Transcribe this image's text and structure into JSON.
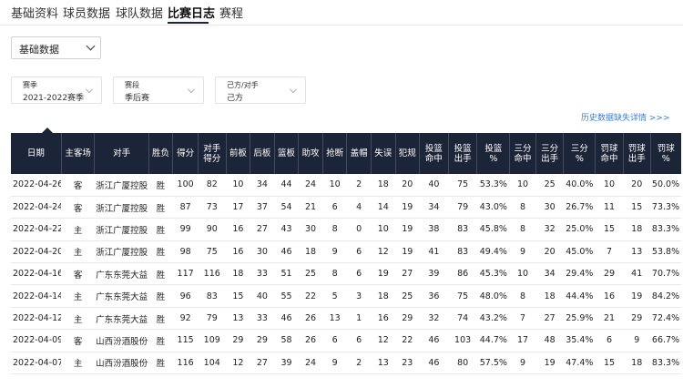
{
  "tabs": [
    {
      "label": "基础资料"
    },
    {
      "label": "球员数据"
    },
    {
      "label": "球队数据"
    },
    {
      "label": "比赛日志"
    },
    {
      "label": "赛程"
    }
  ],
  "stat_select": {
    "value": "基础数据"
  },
  "filters": [
    {
      "label": "赛季",
      "value": "2021-2022赛季"
    },
    {
      "label": "赛段",
      "value": "季后赛"
    },
    {
      "label": "己方/对手",
      "value": "己方"
    }
  ],
  "history_link": "历史数据缺失详情 >>>",
  "table": {
    "headers": [
      [
        "日期"
      ],
      [
        "主客场"
      ],
      [
        "对手"
      ],
      [
        "胜负"
      ],
      [
        "得分"
      ],
      [
        "对手",
        "得分"
      ],
      [
        "前板"
      ],
      [
        "后板"
      ],
      [
        "篮板"
      ],
      [
        "助攻"
      ],
      [
        "抢断"
      ],
      [
        "盖帽"
      ],
      [
        "失误"
      ],
      [
        "犯规"
      ],
      [
        "投篮",
        "命中"
      ],
      [
        "投篮",
        "出手"
      ],
      [
        "投篮",
        "%"
      ],
      [
        "三分",
        "命中"
      ],
      [
        "三分",
        "出手"
      ],
      [
        "三分",
        "%"
      ],
      [
        "罚球",
        "命中"
      ],
      [
        "罚球",
        "出手"
      ],
      [
        "罚球",
        "%"
      ]
    ],
    "rows": [
      [
        "2022-04-26",
        "客",
        "浙江广厦控股",
        "胜",
        "100",
        "82",
        "10",
        "34",
        "44",
        "24",
        "10",
        "2",
        "18",
        "20",
        "40",
        "75",
        "53.3%",
        "10",
        "25",
        "40.0%",
        "10",
        "20",
        "50.0%"
      ],
      [
        "2022-04-24",
        "客",
        "浙江广厦控股",
        "胜",
        "87",
        "73",
        "17",
        "37",
        "54",
        "21",
        "6",
        "4",
        "14",
        "19",
        "34",
        "79",
        "43.0%",
        "8",
        "30",
        "26.7%",
        "11",
        "15",
        "73.3%"
      ],
      [
        "2022-04-22",
        "主",
        "浙江广厦控股",
        "胜",
        "99",
        "90",
        "16",
        "27",
        "43",
        "30",
        "8",
        "0",
        "10",
        "19",
        "38",
        "83",
        "45.8%",
        "8",
        "32",
        "25.0%",
        "15",
        "18",
        "83.3%"
      ],
      [
        "2022-04-20",
        "主",
        "浙江广厦控股",
        "胜",
        "98",
        "75",
        "16",
        "30",
        "46",
        "18",
        "9",
        "6",
        "12",
        "19",
        "41",
        "83",
        "49.4%",
        "9",
        "20",
        "45.0%",
        "7",
        "13",
        "53.8%"
      ],
      [
        "2022-04-16",
        "客",
        "广东东莞大益",
        "胜",
        "117",
        "116",
        "18",
        "33",
        "51",
        "25",
        "8",
        "6",
        "19",
        "27",
        "39",
        "86",
        "45.3%",
        "10",
        "34",
        "29.4%",
        "29",
        "41",
        "70.7%"
      ],
      [
        "2022-04-14",
        "主",
        "广东东莞大益",
        "胜",
        "96",
        "83",
        "15",
        "40",
        "55",
        "22",
        "5",
        "3",
        "18",
        "25",
        "36",
        "75",
        "48.0%",
        "8",
        "18",
        "44.4%",
        "16",
        "19",
        "84.2%"
      ],
      [
        "2022-04-12",
        "主",
        "广东东莞大益",
        "胜",
        "92",
        "79",
        "13",
        "33",
        "46",
        "26",
        "13",
        "1",
        "16",
        "29",
        "32",
        "74",
        "43.2%",
        "7",
        "27",
        "25.9%",
        "21",
        "29",
        "72.4%"
      ],
      [
        "2022-04-09",
        "客",
        "山西汾酒股份",
        "胜",
        "115",
        "109",
        "29",
        "29",
        "58",
        "26",
        "6",
        "6",
        "12",
        "22",
        "46",
        "103",
        "44.7%",
        "17",
        "48",
        "35.4%",
        "6",
        "9",
        "66.7%"
      ],
      [
        "2022-04-07",
        "主",
        "山西汾酒股份",
        "胜",
        "116",
        "104",
        "12",
        "27",
        "39",
        "24",
        "9",
        "2",
        "13",
        "23",
        "46",
        "80",
        "57.5%",
        "9",
        "19",
        "47.4%",
        "15",
        "18",
        "83.3%"
      ]
    ]
  }
}
